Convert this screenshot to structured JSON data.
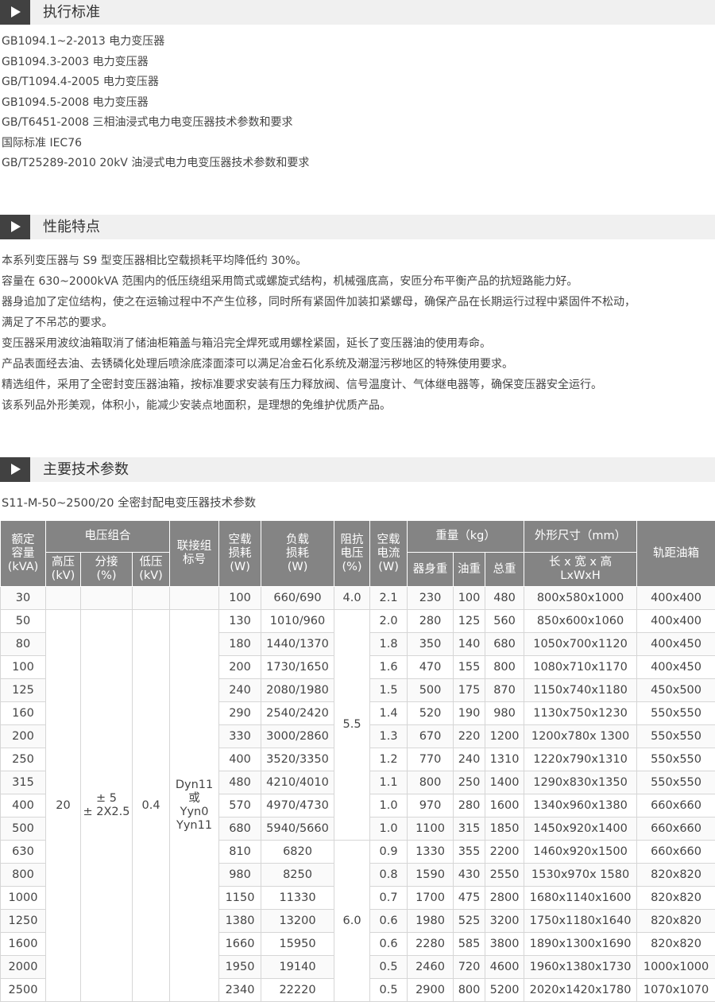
{
  "sections": {
    "standards": {
      "title": "执行标准",
      "items": [
        "GB1094.1~2-2013 电力变压器",
        "GB1094.3-2003 电力变压器",
        "GB/T1094.4-2005 电力变压器",
        "GB1094.5-2008 电力变压器",
        "GB/T6451-2008 三相油浸式电力电变压器技术参数和要求",
        "国际标准 IEC76",
        "GB/T25289-2010 20kV 油浸式电力电变压器技术参数和要求"
      ]
    },
    "features": {
      "title": "性能特点",
      "lines": [
        "本系列变压器与 S9 型变压器相比空载损耗平均降低约 30%。",
        "容量在 630~2000kVA 范围内的低压绕组采用筒式或螺旋式结构，机械强底高，安匝分布平衡产品的抗短路能力好。",
        "器身追加了定位结构，使之在运输过程中不产生位移，同时所有紧固件加装扣紧螺母，确保产品在长期运行过程中紧固件不松动，",
        "满足了不吊芯的要求。",
        "变压器采用波纹油箱取消了储油柜箱盖与箱沿完全焊死或用螺栓紧固，延长了变压器油的使用寿命。",
        "产品表面经去油、去锈磷化处理后喷涂底漆面漆可以满足冶金石化系统及潮湿污秽地区的特殊使用要求。",
        "精选组件，采用了全密封变压器油箱，按标准要求安装有压力释放阀、信号温度计、气体继电器等，确保变压器安全运行。",
        "该系列品外形美观，体积小，能减少安装点地面积，是理想的免维护优质产品。"
      ]
    },
    "params": {
      "title": "主要技术参数",
      "subtitle": "S11-M-50~2500/20 全密封配电变压器技术参数"
    }
  },
  "table": {
    "headers": {
      "capacity": [
        "额定",
        "容量",
        "(kVA)"
      ],
      "voltage_group": "电压组合",
      "hv": [
        "高压",
        "(kV)"
      ],
      "tap": [
        "分接",
        "(%)"
      ],
      "lv": [
        "低压",
        "(kV)"
      ],
      "connection": [
        "联接组",
        "标号"
      ],
      "no_load_loss": [
        "空载",
        "损耗",
        "(W)"
      ],
      "load_loss": [
        "负载",
        "损耗",
        "(W)"
      ],
      "impedance": [
        "阻抗",
        "电压",
        "(%)"
      ],
      "no_load_current": [
        "空载",
        "电流",
        "(W)"
      ],
      "weight": "重量（kg）",
      "body_weight": "器身重",
      "oil_weight": "油重",
      "total_weight": "总重",
      "dimensions": "外形尺寸（mm）",
      "dimensions_sub": [
        "长 x 宽 x 高",
        "LxWxH"
      ],
      "gauge": "轨距油箱"
    },
    "merged": {
      "hv": "20",
      "tap": [
        "± 5",
        "± 2X2.5"
      ],
      "lv": "0.4",
      "connection": [
        "Dyn11",
        "或",
        "Yyn0",
        "Yyn11"
      ],
      "impedance_groups": [
        "4.0",
        "5.5",
        "6.0"
      ]
    },
    "rows": [
      {
        "capacity": "30",
        "no_load_loss": "100",
        "load_loss": "660/690",
        "current": "2.1",
        "body": "230",
        "oil": "100",
        "total": "480",
        "dims": "800x580x1000",
        "gauge": "400x400"
      },
      {
        "capacity": "50",
        "no_load_loss": "130",
        "load_loss": "1010/960",
        "current": "2.0",
        "body": "280",
        "oil": "125",
        "total": "560",
        "dims": "850x600x1060",
        "gauge": "400x400"
      },
      {
        "capacity": "80",
        "no_load_loss": "180",
        "load_loss": "1440/1370",
        "current": "1.8",
        "body": "350",
        "oil": "140",
        "total": "680",
        "dims": "1050x700x1120",
        "gauge": "400x450"
      },
      {
        "capacity": "100",
        "no_load_loss": "200",
        "load_loss": "1730/1650",
        "current": "1.6",
        "body": "470",
        "oil": "155",
        "total": "800",
        "dims": "1080x710x1170",
        "gauge": "400x450"
      },
      {
        "capacity": "125",
        "no_load_loss": "240",
        "load_loss": "2080/1980",
        "current": "1.5",
        "body": "500",
        "oil": "175",
        "total": "870",
        "dims": "1150x740x1180",
        "gauge": "450x500"
      },
      {
        "capacity": "160",
        "no_load_loss": "290",
        "load_loss": "2540/2420",
        "current": "1.4",
        "body": "520",
        "oil": "190",
        "total": "980",
        "dims": "1130x750x1230",
        "gauge": "550x550"
      },
      {
        "capacity": "200",
        "no_load_loss": "330",
        "load_loss": "3000/2860",
        "current": "1.3",
        "body": "670",
        "oil": "220",
        "total": "1200",
        "dims": "1200x780x 1300",
        "gauge": "550x550"
      },
      {
        "capacity": "250",
        "no_load_loss": "400",
        "load_loss": "3520/3350",
        "current": "1.2",
        "body": "770",
        "oil": "240",
        "total": "1310",
        "dims": "1220x790x1310",
        "gauge": "550x550"
      },
      {
        "capacity": "315",
        "no_load_loss": "480",
        "load_loss": "4210/4010",
        "current": "1.1",
        "body": "800",
        "oil": "250",
        "total": "1400",
        "dims": "1290x830x1350",
        "gauge": "550x550"
      },
      {
        "capacity": "400",
        "no_load_loss": "570",
        "load_loss": "4970/4730",
        "current": "1.0",
        "body": "970",
        "oil": "280",
        "total": "1600",
        "dims": "1340x960x1380",
        "gauge": "660x660"
      },
      {
        "capacity": "500",
        "no_load_loss": "680",
        "load_loss": "5940/5660",
        "current": "1.0",
        "body": "1100",
        "oil": "315",
        "total": "1850",
        "dims": "1450x920x1400",
        "gauge": "660x660"
      },
      {
        "capacity": "630",
        "no_load_loss": "810",
        "load_loss": "6820",
        "current": "0.9",
        "body": "1330",
        "oil": "355",
        "total": "2200",
        "dims": "1460x920x1500",
        "gauge": "660x660"
      },
      {
        "capacity": "800",
        "no_load_loss": "980",
        "load_loss": "8250",
        "current": "0.8",
        "body": "1590",
        "oil": "430",
        "total": "2550",
        "dims": "1530x970x 1580",
        "gauge": "820x820"
      },
      {
        "capacity": "1000",
        "no_load_loss": "1150",
        "load_loss": "11330",
        "current": "0.7",
        "body": "1700",
        "oil": "475",
        "total": "2800",
        "dims": "1680x1140x1600",
        "gauge": "820x820"
      },
      {
        "capacity": "1250",
        "no_load_loss": "1380",
        "load_loss": "13200",
        "current": "0.6",
        "body": "1980",
        "oil": "525",
        "total": "3200",
        "dims": "1750x1180x1640",
        "gauge": "820x820"
      },
      {
        "capacity": "1600",
        "no_load_loss": "1660",
        "load_loss": "15950",
        "current": "0.6",
        "body": "2280",
        "oil": "585",
        "total": "3800",
        "dims": "1890x1300x1690",
        "gauge": "820x820"
      },
      {
        "capacity": "2000",
        "no_load_loss": "1950",
        "load_loss": "19140",
        "current": "0.5",
        "body": "2460",
        "oil": "720",
        "total": "4600",
        "dims": "1960x1380x1730",
        "gauge": "1000x1000"
      },
      {
        "capacity": "2500",
        "no_load_loss": "2340",
        "load_loss": "22220",
        "current": "0.5",
        "body": "2900",
        "oil": "800",
        "total": "5200",
        "dims": "2020x1420x1780",
        "gauge": "1070x1070"
      }
    ]
  }
}
